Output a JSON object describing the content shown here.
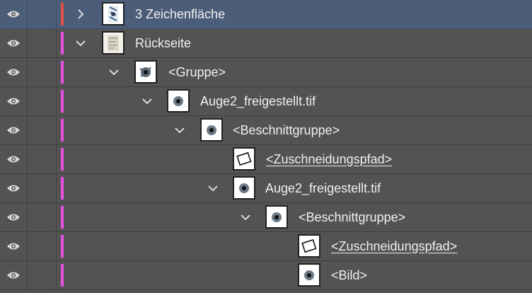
{
  "layers": [
    {
      "label": "3 Zeichenfläche",
      "expand": "chevron-right-icon",
      "thumb": "artboard-thumb",
      "bar": "#e0504a",
      "selected": true,
      "indent": 0,
      "type": "artboard"
    },
    {
      "label": "Rückseite",
      "expand": "chevron-down-icon",
      "thumb": "layer-thumb",
      "bar": "#e550e0",
      "selected": false,
      "indent": 0,
      "type": "layer"
    },
    {
      "label": "<Gruppe>",
      "expand": "chevron-down-icon",
      "thumb": "eye-image-thumb",
      "bar": "#e550e0",
      "selected": false,
      "indent": 1,
      "type": "group"
    },
    {
      "label": "Auge2_freigestellt.tif",
      "expand": "chevron-down-icon",
      "thumb": "eye-image-thumb",
      "bar": "#e550e0",
      "selected": false,
      "indent": 2,
      "type": "image"
    },
    {
      "label": "<Beschnittgruppe>",
      "expand": "chevron-down-icon",
      "thumb": "eye-image-thumb",
      "bar": "#e550e0",
      "selected": false,
      "indent": 3,
      "type": "clipgroup"
    },
    {
      "label": "<Zuschneidungspfad>",
      "expand": "",
      "thumb": "clip-path-thumb",
      "bar": "#e550e0",
      "selected": false,
      "indent": 4,
      "type": "path"
    },
    {
      "label": "Auge2_freigestellt.tif",
      "expand": "chevron-down-icon",
      "thumb": "eye-image-thumb",
      "bar": "#e550e0",
      "selected": false,
      "indent": 4,
      "type": "image"
    },
    {
      "label": "<Beschnittgruppe>",
      "expand": "chevron-down-icon",
      "thumb": "eye-image-thumb",
      "bar": "#e550e0",
      "selected": false,
      "indent": 5,
      "type": "clipgroup"
    },
    {
      "label": "<Zuschneidungspfad>",
      "expand": "",
      "thumb": "clip-path-thumb",
      "bar": "#e550e0",
      "selected": false,
      "indent": 6,
      "type": "path"
    },
    {
      "label": "<Bild>",
      "expand": "",
      "thumb": "eye-image-thumb",
      "bar": "#e550e0",
      "selected": false,
      "indent": 6,
      "type": "image"
    }
  ]
}
